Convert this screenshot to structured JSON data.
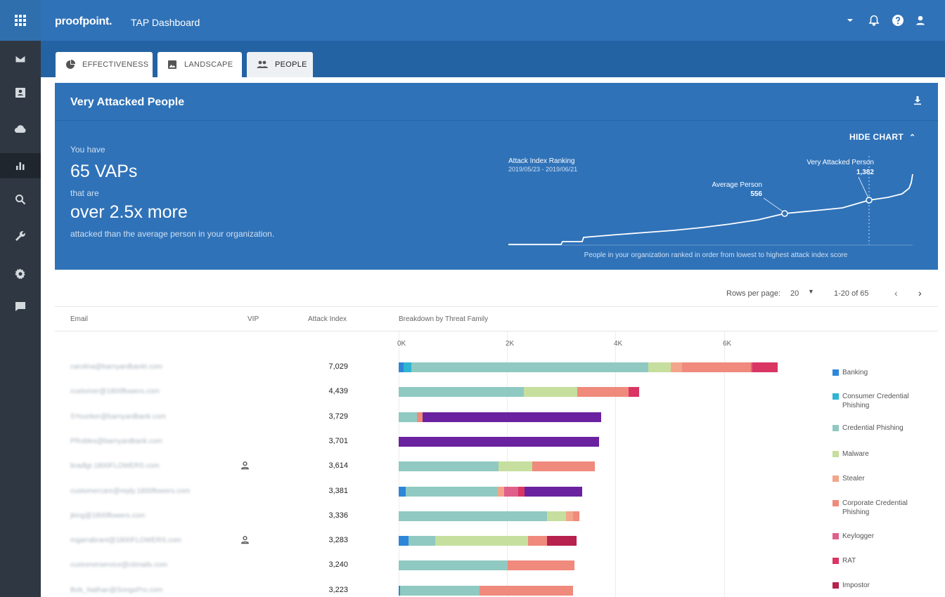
{
  "colors": {
    "topbar": "#2f72b8",
    "rail": "#2f3842",
    "Banking": "#2e86d9",
    "Consumer Credential Phishing": "#2fb5d3",
    "Credential Phishing": "#8fc9c1",
    "Malware": "#c6df9e",
    "Stealer": "#f3a58a",
    "Corporate Credential Phishing": "#ef8a7c",
    "Keylogger": "#e0608c",
    "RAT": "#d93663",
    "Impostor": "#b5224d",
    "Purple": "#6a22a0"
  },
  "rail": {
    "icons": [
      "apps-grid-icon",
      "mail-icon",
      "contact-card-icon",
      "cloud-icon",
      "bar-chart-icon",
      "search-icon",
      "wrench-icon",
      "gear-icon",
      "message-icon"
    ],
    "active": "bar-chart-icon"
  },
  "header": {
    "brand": "proofpoint.",
    "title": "TAP Dashboard",
    "icons": [
      "caret-down-icon",
      "bell-icon",
      "help-icon",
      "user-icon"
    ]
  },
  "tabs": [
    {
      "label": "EFFECTIVENESS",
      "icon": "pie-chart-icon"
    },
    {
      "label": "LANDSCAPE",
      "icon": "image-icon"
    },
    {
      "label": "PEOPLE",
      "icon": "people-icon",
      "active": true
    }
  ],
  "panel": {
    "title": "Very Attacked People",
    "download_icon": "download-icon"
  },
  "hero": {
    "line1": "You have",
    "vap_count": "65 VAPs",
    "line2": "that are",
    "multiplier": "over 2.5x more",
    "line3": "attacked than the average person in your organization.",
    "hide_chart": "HIDE CHART",
    "ranking_title": "Attack Index Ranking",
    "ranking_dates": "2019/05/23 - 2019/06/21",
    "avg_label": "Average Person",
    "avg_value": "556",
    "vap_label": "Very Attacked Person",
    "vap_value": "1,382",
    "caption": "People in your organization ranked in order from lowest to highest attack index score"
  },
  "pager": {
    "rows_label": "Rows per page:",
    "rows_value": "20",
    "range": "1-20 of 65"
  },
  "table": {
    "columns": [
      "Email",
      "VIP",
      "Attack Index",
      "Breakdown by Threat Family"
    ],
    "axis_ticks": [
      "0K",
      "2K",
      "4K",
      "6K"
    ],
    "rows": [
      {
        "email": "carolina@barnyardbankt.com",
        "vip": false,
        "attack_index": "7,029",
        "segments": [
          [
            "Banking",
            90
          ],
          [
            "Consumer Credential Phishing",
            150
          ],
          [
            "Credential Phishing",
            4360
          ],
          [
            "Malware",
            420
          ],
          [
            "Stealer",
            210
          ],
          [
            "Corporate Credential Phishing",
            1270
          ],
          [
            "Keylogger",
            30
          ],
          [
            "RAT",
            460
          ]
        ]
      },
      {
        "email": "customer@1800flowers.com",
        "vip": false,
        "attack_index": "4,439",
        "segments": [
          [
            "Credential Phishing",
            2310
          ],
          [
            "Malware",
            990
          ],
          [
            "Corporate Credential Phishing",
            940
          ],
          [
            "RAT",
            200
          ]
        ]
      },
      {
        "email": "SYounker@barnyardbank.com",
        "vip": false,
        "attack_index": "3,729",
        "segments": [
          [
            "Credential Phishing",
            340
          ],
          [
            "Corporate Credential Phishing",
            100
          ],
          [
            "Purple",
            3290
          ]
        ]
      },
      {
        "email": "PRobles@barnyardbank.com",
        "vip": false,
        "attack_index": "3,701",
        "segments": [
          [
            "Purple",
            3701
          ]
        ]
      },
      {
        "email": "bradlgr.1800FLOWERS.com",
        "vip": true,
        "attack_index": "3,614",
        "segments": [
          [
            "Credential Phishing",
            1840
          ],
          [
            "Malware",
            620
          ],
          [
            "Corporate Credential Phishing",
            1154
          ]
        ]
      },
      {
        "email": "customercare@reply.1800flowers.com",
        "vip": false,
        "attack_index": "3,381",
        "segments": [
          [
            "Banking",
            130
          ],
          [
            "Credential Phishing",
            1680
          ],
          [
            "Stealer",
            140
          ],
          [
            "Keylogger",
            250
          ],
          [
            "RAT",
            120
          ],
          [
            "Purple",
            1061
          ]
        ]
      },
      {
        "email": "jking@1800flowers.com",
        "vip": false,
        "attack_index": "3,336",
        "segments": [
          [
            "Credential Phishing",
            2730
          ],
          [
            "Malware",
            360
          ],
          [
            "Stealer",
            120
          ],
          [
            "Corporate Credential Phishing",
            126
          ]
        ]
      },
      {
        "email": "mgarrabrant@1800FLOWERS.com",
        "vip": true,
        "attack_index": "3,283",
        "segments": [
          [
            "Banking",
            180
          ],
          [
            "Credential Phishing",
            490
          ],
          [
            "Malware",
            1710
          ],
          [
            "Corporate Credential Phishing",
            350
          ],
          [
            "Impostor",
            553
          ]
        ]
      },
      {
        "email": "customerservice@ctimails.com",
        "vip": false,
        "attack_index": "3,240",
        "segments": [
          [
            "Credential Phishing",
            2010
          ],
          [
            "Corporate Credential Phishing",
            1230
          ]
        ]
      },
      {
        "email": "Bob_Nathan@SongsPro.com",
        "vip": false,
        "attack_index": "3,223",
        "segments": [
          [
            "Banking",
            30
          ],
          [
            "Credential Phishing",
            1460
          ],
          [
            "Corporate Credential Phishing",
            1733
          ]
        ]
      }
    ]
  },
  "legend": [
    {
      "label": "Banking"
    },
    {
      "label": "Consumer Credential Phishing"
    },
    {
      "label": "Credential Phishing"
    },
    {
      "label": "Malware"
    },
    {
      "label": "Stealer"
    },
    {
      "label": "Corporate Credential Phishing"
    },
    {
      "label": "Keylogger"
    },
    {
      "label": "RAT"
    },
    {
      "label": "Impostor"
    }
  ]
}
